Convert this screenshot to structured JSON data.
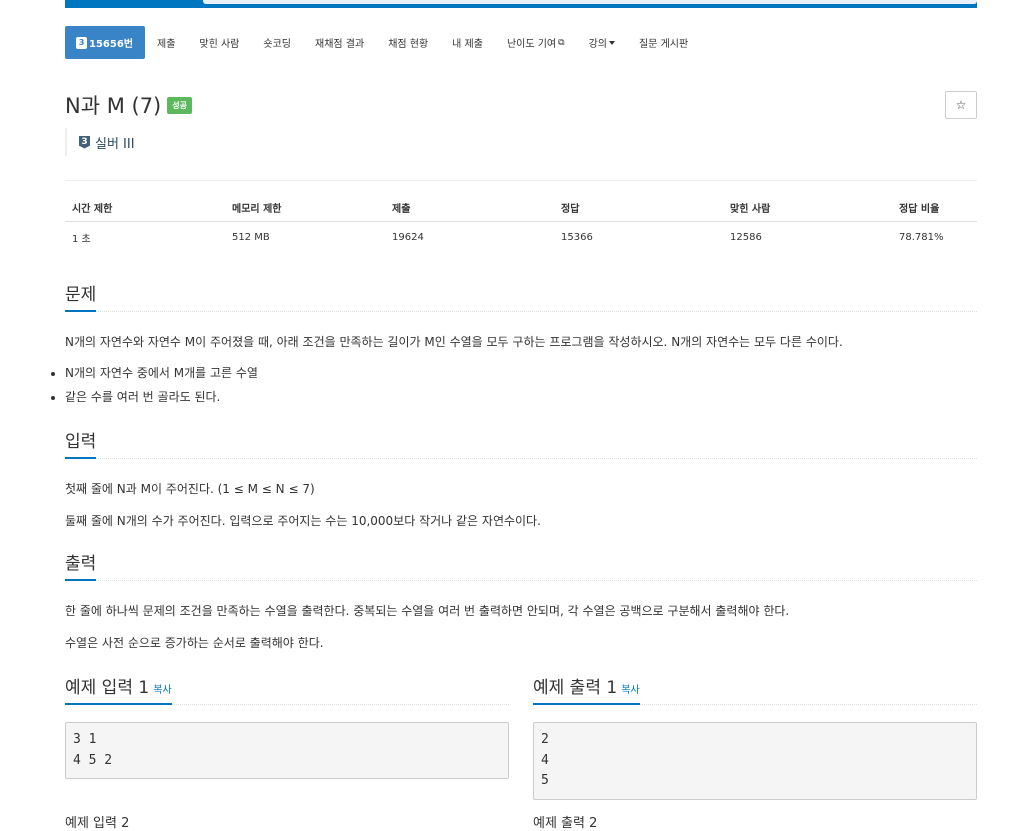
{
  "tabs": [
    {
      "label": "15656번",
      "tier_badge": "3",
      "active": true
    },
    {
      "label": "제출"
    },
    {
      "label": "맞힌 사람"
    },
    {
      "label": "숏코딩"
    },
    {
      "label": "재채점 결과"
    },
    {
      "label": "채점 현황"
    },
    {
      "label": "내 제출"
    },
    {
      "label": "난이도 기여"
    },
    {
      "label": "강의"
    },
    {
      "label": "질문 게시판"
    }
  ],
  "problem": {
    "title": "N과 M (7)",
    "status_badge": "성공",
    "star_glyph": "☆",
    "tier_number": "3",
    "tier_label": "실버 III"
  },
  "info_table": {
    "headers": [
      "시간 제한",
      "메모리 제한",
      "제출",
      "정답",
      "맞힌 사람",
      "정답 비율"
    ],
    "values": [
      "1 초",
      "512 MB",
      "19624",
      "15366",
      "12586",
      "78.781%"
    ]
  },
  "sections": {
    "problem": {
      "title": "문제",
      "text": "N개의 자연수와 자연수 M이 주어졌을 때, 아래 조건을 만족하는 길이가 M인 수열을 모두 구하는 프로그램을 작성하시오. N개의 자연수는 모두 다른 수이다.",
      "conditions": [
        "N개의 자연수 중에서 M개를 고른 수열",
        "같은 수를 여러 번 골라도 된다."
      ]
    },
    "input": {
      "title": "입력",
      "lines": [
        "첫째 줄에 N과 M이 주어진다. (1 ≤ M ≤ N ≤ 7)",
        "둘째 줄에 N개의 수가 주어진다. 입력으로 주어지는 수는 10,000보다 작거나 같은 자연수이다."
      ]
    },
    "output": {
      "title": "출력",
      "lines": [
        "한 줄에 하나씩 문제의 조건을 만족하는 수열을 출력한다. 중복되는 수열을 여러 번 출력하면 안되며, 각 수열은 공백으로 구분해서 출력해야 한다.",
        "수열은 사전 순으로 증가하는 순서로 출력해야 한다."
      ]
    }
  },
  "samples": {
    "input_title": "예제 입력 1",
    "output_title": "예제 출력 1",
    "copy_label": "복사",
    "input_text": "3 1\n4 5 2",
    "output_text": "2\n4\n5",
    "next_input_title": "예제 입력 2",
    "next_output_title": "예제 출력 2"
  },
  "colors": {
    "accent": "#0076c0",
    "active_tab": "#3984c7",
    "success": "#5cb85c",
    "tier": "#435f7a"
  }
}
